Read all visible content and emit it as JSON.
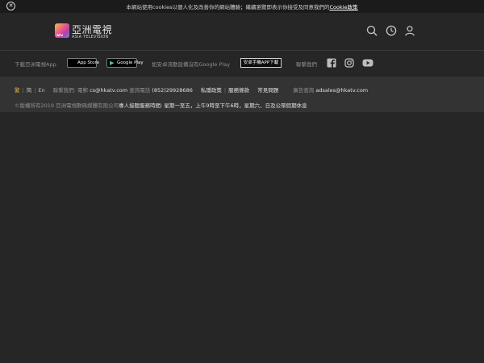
{
  "cookie_bar": {
    "close_glyph": "✕",
    "message": "本網站使用cookies以個人化及改善你的網站體驗；繼續瀏覽即表示你接受及同意我們的",
    "link_label": "Cookie政策"
  },
  "header": {
    "logo": {
      "mark_text": "atv",
      "chinese_name": "亞洲電視",
      "english_name": "ASIA TELEVISION"
    },
    "icons": [
      "search-icon",
      "clock-icon",
      "user-icon"
    ]
  },
  "download": {
    "app_label": "下載亞洲電視App",
    "app_store": {
      "small": "",
      "label": "App Store"
    },
    "google_play": {
      "label": "Google Play"
    },
    "android_note": "如安卓流動設備沒有Google Play",
    "android_button": "安卓手機APP下載",
    "contact_label": "聯繫我們",
    "social": [
      "facebook-icon",
      "instagram-icon",
      "youtube-icon"
    ]
  },
  "info": {
    "lang_trad": "繁",
    "lang_simp": "简",
    "lang_en": "En",
    "contact_label": "聯繫我們: 電郵",
    "contact_email": "cs@hkatv.com",
    "enquiry_label": "查詢電話",
    "enquiry_phone": "(852)29928686",
    "privacy": "私隱政策",
    "terms": "服務條款",
    "faq": "常見問題",
    "ads_label": "廣告查詢",
    "ads_email": "adsales@hkatv.com",
    "copyright": "©版權所有2019 亞洲電視數碼媒體有限公司",
    "hours": "專人接聽服務時間: 星期一至五，上午9時至下午6時，星期六、日及公眾假期休息"
  },
  "colors": {
    "background": "#262626",
    "info_bar": "#333333",
    "accent_yellow": "#e2b33a"
  }
}
